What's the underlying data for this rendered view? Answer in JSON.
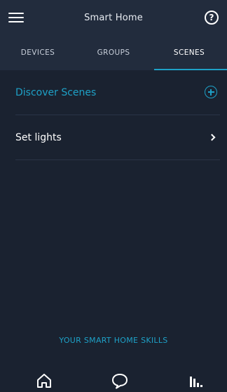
{
  "header": {
    "title": "Smart Home"
  },
  "tabs": [
    {
      "label": "DEVICES",
      "active": false
    },
    {
      "label": "GROUPS",
      "active": false
    },
    {
      "label": "SCENES",
      "active": true
    }
  ],
  "list": [
    {
      "label": "Discover Scenes",
      "icon": "plus-circle-icon"
    },
    {
      "label": "Set lights",
      "icon": "chevron-right-icon"
    }
  ],
  "skills_link": "YOUR SMART HOME SKILLS",
  "bottom_nav": [
    {
      "icon": "home-icon"
    },
    {
      "icon": "chat-icon"
    },
    {
      "icon": "activity-icon"
    }
  ],
  "colors": {
    "accent": "#1ea1c7",
    "background": "#1a2230",
    "header": "#222c3d"
  }
}
